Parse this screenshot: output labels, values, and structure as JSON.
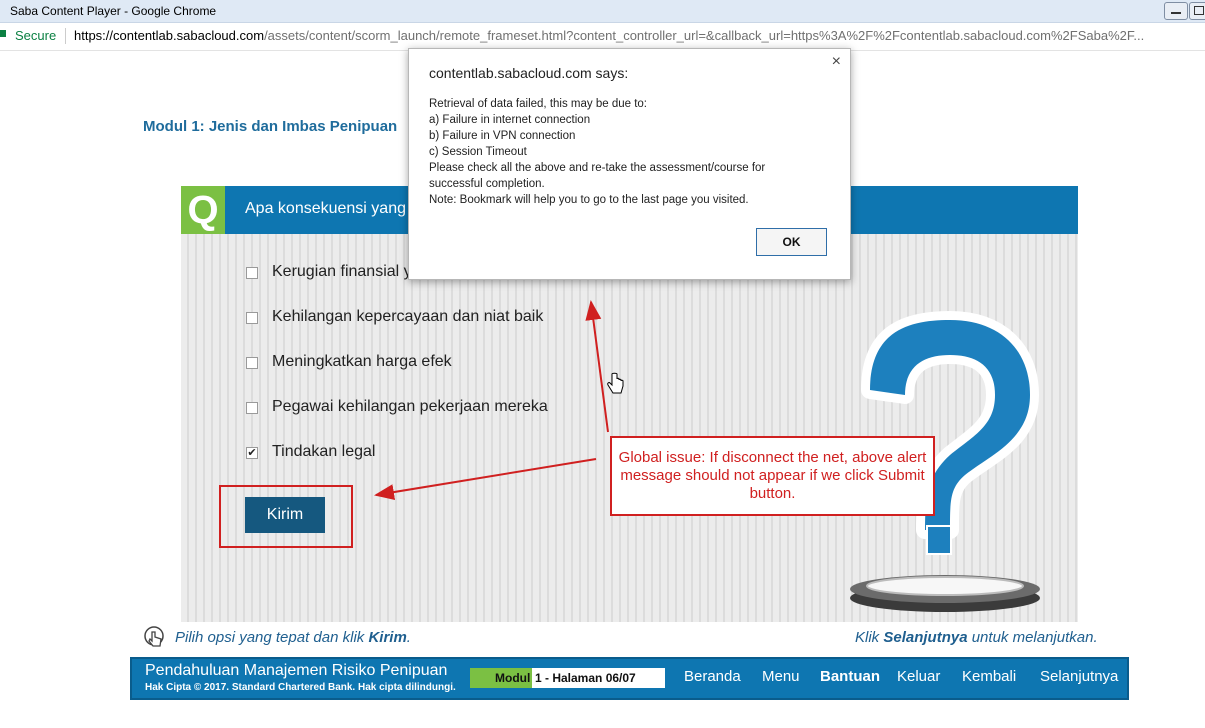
{
  "window": {
    "title": "Saba Content Player - Google Chrome"
  },
  "address_bar": {
    "secure_label": "Secure",
    "url_host": "https://contentlab.sabacloud.com",
    "url_rest": "/assets/content/scorm_launch/remote_frameset.html?content_controller_url=&callback_url=https%3A%2F%2Fcontentlab.sabacloud.com%2FSaba%2F..."
  },
  "module_title": "Modul 1: Jenis dan Imbas Penipuan",
  "question": {
    "badge": "Q",
    "text": "Apa konsekuensi yang",
    "options": [
      {
        "label": "Kerugian finansial yang signifikan",
        "checked": false
      },
      {
        "label": "Kehilangan kepercayaan dan niat baik",
        "checked": false
      },
      {
        "label": "Meningkatkan harga efek",
        "checked": false
      },
      {
        "label": "Pegawai kehilangan pekerjaan mereka",
        "checked": false
      },
      {
        "label": "Tindakan legal",
        "checked": true
      }
    ],
    "submit_label": "Kirim"
  },
  "annotation": "Global issue: If disconnect the net, above alert message should not appear if we click Submit button.",
  "instructions": {
    "left_prefix": "Pilih opsi yang tepat dan klik ",
    "left_bold": "Kirim",
    "left_suffix": ".",
    "right_prefix": "Klik ",
    "right_bold": "Selanjutnya",
    "right_suffix": " untuk melanjutkan."
  },
  "footer": {
    "course_title": "Pendahuluan Manajemen Risiko Penipuan",
    "copyright": "Hak Cipta © 2017. Standard Chartered Bank. Hak cipta dilindungi.",
    "progress_module": "Modul",
    "progress_page": "1 - Halaman 06/07",
    "nav": [
      "Beranda",
      "Menu",
      "Bantuan",
      "Keluar",
      "Kembali",
      "Selanjutnya"
    ]
  },
  "dialog": {
    "title": "contentlab.sabacloud.com says:",
    "lines": [
      "Retrieval of data failed, this may be due to:",
      "a) Failure in internet connection",
      "b) Failure in VPN connection",
      "c) Session Timeout",
      "Please check all the above and re-take the assessment/course for",
      "successful completion.",
      "Note: Bookmark will help you to go to the last page you visited."
    ],
    "ok_label": "OK",
    "close_glyph": "×"
  },
  "colors": {
    "brand_blue": "#0e76b1",
    "brand_green": "#7bc043",
    "annotation_red": "#d02020"
  }
}
